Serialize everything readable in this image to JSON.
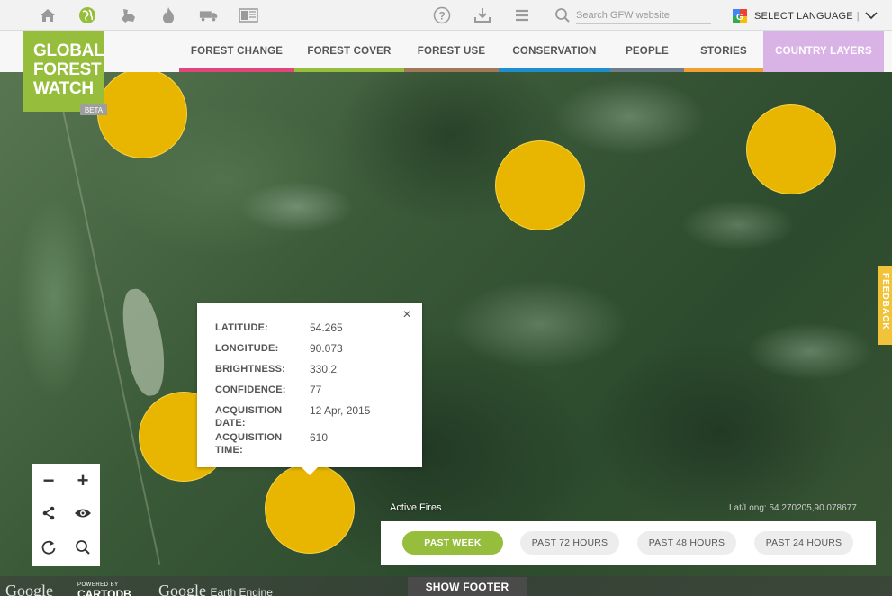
{
  "topbar": {
    "icons": [
      "home-icon",
      "globe-icon",
      "countries-icon",
      "fire-icon",
      "truck-icon",
      "stories-icon"
    ],
    "right_icons": [
      "help-icon",
      "download-icon",
      "menu-icon"
    ],
    "search": {
      "placeholder": "Search GFW website"
    },
    "language": {
      "label": "SELECT LANGUAGE",
      "separator": "|"
    }
  },
  "logo": {
    "line1": "GLOBAL",
    "line2": "FOREST",
    "line3": "WATCH",
    "badge": "BETA"
  },
  "nav": {
    "items": [
      {
        "label": "FOREST CHANGE",
        "color": "#e0457b"
      },
      {
        "label": "FOREST COVER",
        "color": "#97bd3d"
      },
      {
        "label": "FOREST USE",
        "color": "#a0785a"
      },
      {
        "label": "CONSERVATION",
        "color": "#1f8ecf"
      },
      {
        "label": "PEOPLE",
        "color": "#707d8a"
      },
      {
        "label": "STORIES",
        "color": "#f0a030"
      },
      {
        "label": "COUNTRY LAYERS",
        "color": "#d9b3e6"
      }
    ]
  },
  "popup": {
    "close": "×",
    "rows": [
      {
        "label": "LATITUDE:",
        "value": "54.265"
      },
      {
        "label": "LONGITUDE:",
        "value": "90.073"
      },
      {
        "label": "BRIGHTNESS:",
        "value": "330.2"
      },
      {
        "label": "CONFIDENCE:",
        "value": "77"
      },
      {
        "label": "ACQUISITION DATE:",
        "value": "12 Apr, 2015"
      },
      {
        "label": "ACQUISITION TIME:",
        "value": "610"
      }
    ]
  },
  "controls": {
    "zoom_out": "−",
    "zoom_in": "+"
  },
  "feedback": {
    "label": "FEEDBACK"
  },
  "map": {
    "layer_label": "Active Fires",
    "latlong": "Lat/Long: 54.270205,90.078677"
  },
  "timeline": {
    "buttons": [
      {
        "label": "PAST WEEK",
        "active": true
      },
      {
        "label": "PAST 72 HOURS",
        "active": false
      },
      {
        "label": "PAST 48 HOURS",
        "active": false
      },
      {
        "label": "PAST 24 HOURS",
        "active": false
      }
    ]
  },
  "footer": {
    "google1": "Google",
    "powered_by": "POWERED BY",
    "cartodb": "CARTODB",
    "google2": "Google",
    "earth_engine": "Earth Engine",
    "show_footer": "SHOW FOOTER"
  },
  "colors": {
    "brand_green": "#97bd3d",
    "fire_yellow": "#e8b600"
  }
}
